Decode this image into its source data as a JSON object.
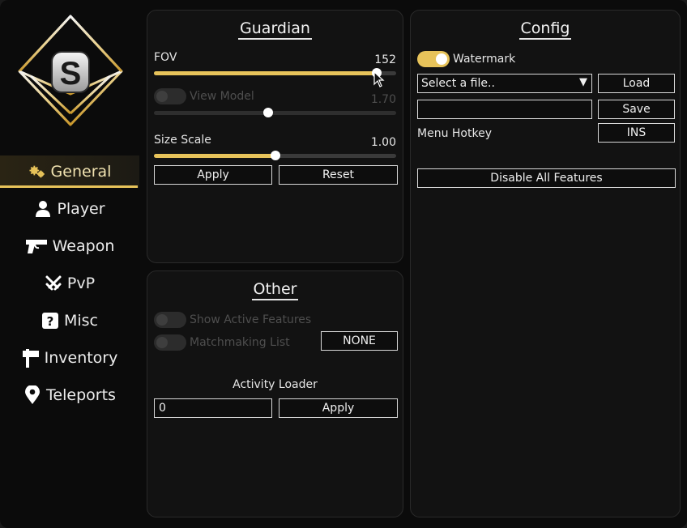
{
  "brand": {
    "logo_letter": "S",
    "accent_color": "#e7c35a"
  },
  "nav": {
    "items": [
      {
        "label": "General",
        "icon": "gears-icon",
        "active": true
      },
      {
        "label": "Player",
        "icon": "person-icon",
        "active": false
      },
      {
        "label": "Weapon",
        "icon": "pistol-icon",
        "active": false
      },
      {
        "label": "PvP",
        "icon": "crossed-swords-icon",
        "active": false
      },
      {
        "label": "Misc",
        "icon": "question-box-icon",
        "active": false
      },
      {
        "label": "Inventory",
        "icon": "signpost-icon",
        "active": false
      },
      {
        "label": "Teleports",
        "icon": "map-pin-icon",
        "active": false
      }
    ]
  },
  "guardian": {
    "title": "Guardian",
    "fov": {
      "label": "FOV",
      "value": "152",
      "fraction": 0.92
    },
    "view_model": {
      "label": "View Model",
      "value": "1.70",
      "enabled": false,
      "fraction": 0.47
    },
    "size_scale": {
      "label": "Size Scale",
      "value": "1.00",
      "fraction": 0.5
    },
    "apply_label": "Apply",
    "reset_label": "Reset"
  },
  "other": {
    "title": "Other",
    "show_active_features": {
      "label": "Show Active Features",
      "enabled": false
    },
    "matchmaking_list": {
      "label": "Matchmaking List",
      "enabled": false,
      "key_label": "NONE"
    },
    "activity_loader": {
      "label": "Activity Loader",
      "input_value": "0",
      "apply_label": "Apply"
    }
  },
  "config": {
    "title": "Config",
    "watermark": {
      "label": "Watermark",
      "enabled": true
    },
    "file_select": {
      "value": "Select a file..",
      "arrow": "▼"
    },
    "load_label": "Load",
    "name_input_value": "",
    "save_label": "Save",
    "menu_hotkey": {
      "label": "Menu Hotkey",
      "key_label": "INS"
    },
    "disable_all_label": "Disable All Features"
  }
}
